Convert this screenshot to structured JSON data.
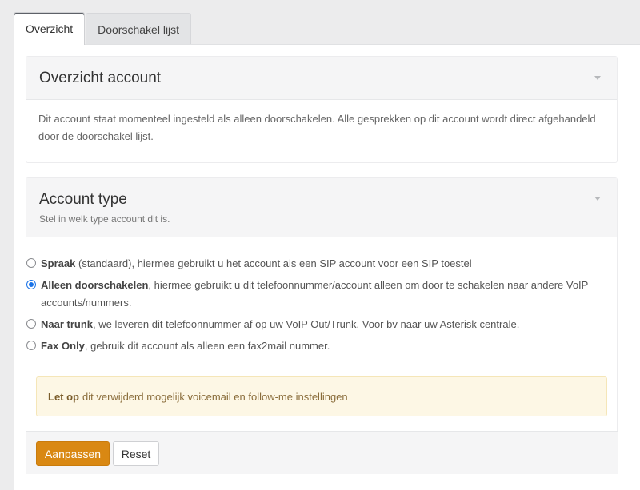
{
  "tabs": [
    {
      "label": "Overzicht",
      "active": true
    },
    {
      "label": "Doorschakel lijst",
      "active": false
    }
  ],
  "overview_card": {
    "title": "Overzicht account",
    "body": "Dit account staat momenteel ingesteld als alleen doorschakelen. Alle gesprekken op dit account wordt direct afgehandeld door de doorschakel lijst."
  },
  "account_type_card": {
    "title": "Account type",
    "subtitle": "Stel in welk type account dit is.",
    "options": [
      {
        "name": "Spraak",
        "description": " (standaard), hiermee gebruikt u het account als een SIP account voor een SIP toestel",
        "checked": false
      },
      {
        "name": "Alleen doorschakelen",
        "description": ", hiermee gebruikt u dit telefoonnummer/account alleen om door te schakelen naar andere VoIP accounts/nummers.",
        "checked": true
      },
      {
        "name": "Naar trunk",
        "description": ", we leveren dit telefoonnummer af op uw VoIP Out/Trunk. Voor bv naar uw Asterisk centrale.",
        "checked": false
      },
      {
        "name": "Fax Only",
        "description": ", gebruik dit account als alleen een fax2mail nummer.",
        "checked": false
      }
    ],
    "alert": {
      "strong": "Let op",
      "text": "dit verwijderd mogelijk voicemail en follow-me instellingen"
    },
    "buttons": {
      "submit": "Aanpassen",
      "reset": "Reset"
    }
  },
  "colors": {
    "primary_button": "#d98813",
    "radio_checked": "#1a73e8",
    "alert_bg": "#fdf7e5"
  }
}
